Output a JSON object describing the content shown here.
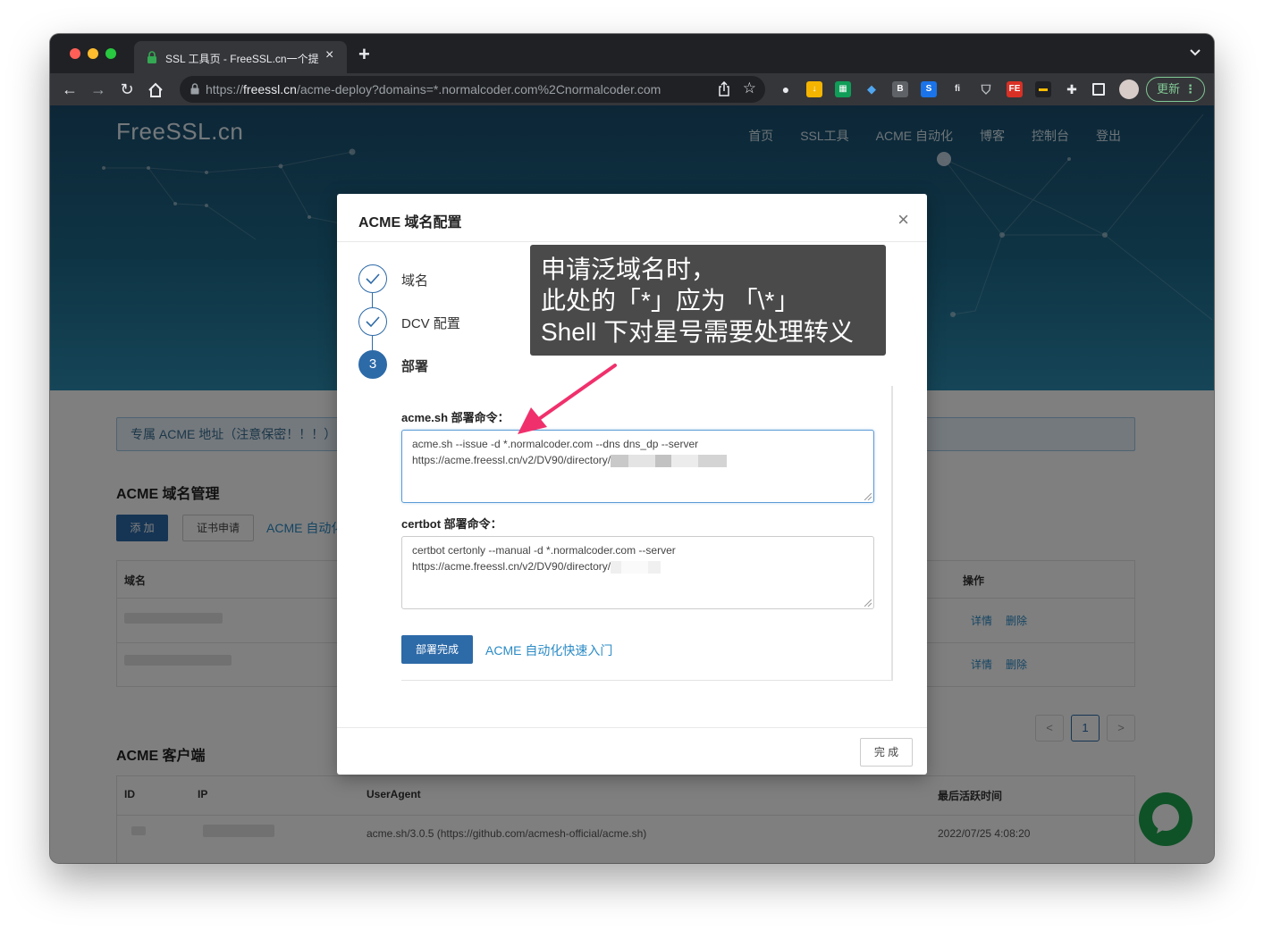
{
  "browser": {
    "tab_title": "SSL 工具页 - FreeSSL.cn一个提",
    "url_scheme": "https://",
    "url_host": "freessl.cn",
    "url_path": "/acme-deploy?domains=*.normalcoder.com%2Cnormalcoder.com",
    "update_label": "更新",
    "update_dots": "⋮",
    "extensions": [
      "github-icon",
      "download-icon",
      "grid-icon",
      "gem-icon",
      "bookmark-icon",
      "s-icon",
      "fi-icon",
      "shield-icon",
      "fe-icon",
      "terminal-icon",
      "puzzle-icon",
      "sidebar-icon",
      "avatar"
    ]
  },
  "site": {
    "brand": "FreeSSL.cn",
    "nav": [
      "首页",
      "SSL工具",
      "ACME 自动化",
      "博客",
      "控制台",
      "登出"
    ]
  },
  "background": {
    "notice": "专属 ACME 地址（注意保密！！！）",
    "domain_section_title": "ACME 域名管理",
    "add_button": "添 加",
    "cert_button": "证书申请",
    "acme_link": "ACME 自动化",
    "table_domain_header": "域名",
    "table_ops_header": "操作",
    "row_detail": "详情",
    "row_delete": "删除",
    "page_prev": "<",
    "page_current": "1",
    "page_next": ">",
    "client_section_title": "ACME 客户端",
    "client_headers": {
      "id": "ID",
      "ip": "IP",
      "ua": "UserAgent",
      "last": "最后活跃时间"
    },
    "client_row": {
      "ua": "acme.sh/3.0.5 (https://github.com/acmesh-official/acme.sh)",
      "last": "2022/07/25 4:08:20"
    }
  },
  "modal": {
    "title": "ACME 域名配置",
    "close": "×",
    "steps": [
      {
        "label": "域名",
        "state": "done"
      },
      {
        "label": "DCV 配置",
        "state": "done"
      },
      {
        "label": "部署",
        "state": "active",
        "number": "3"
      }
    ],
    "acme_label": "acme.sh 部署命令：",
    "acme_line1": "acme.sh --issue -d *.normalcoder.com  --dns dns_dp --server",
    "acme_line2": "https://acme.freessl.cn/v2/DV90/directory/",
    "certbot_label": "certbot 部署命令：",
    "certbot_line1": "certbot certonly --manual -d *.normalcoder.com  --server",
    "certbot_line2": "https://acme.freessl.cn/v2/DV90/directory/",
    "deploy_done": "部署完成",
    "quickstart_link": "ACME 自动化快速入门",
    "finish": "完 成"
  },
  "annotation": {
    "line1": "申请泛域名时，",
    "line2": "此处的「*」应为 「\\*」",
    "line3": "Shell 下对星号需要处理转义",
    "arrow_color": "#f0306c"
  }
}
